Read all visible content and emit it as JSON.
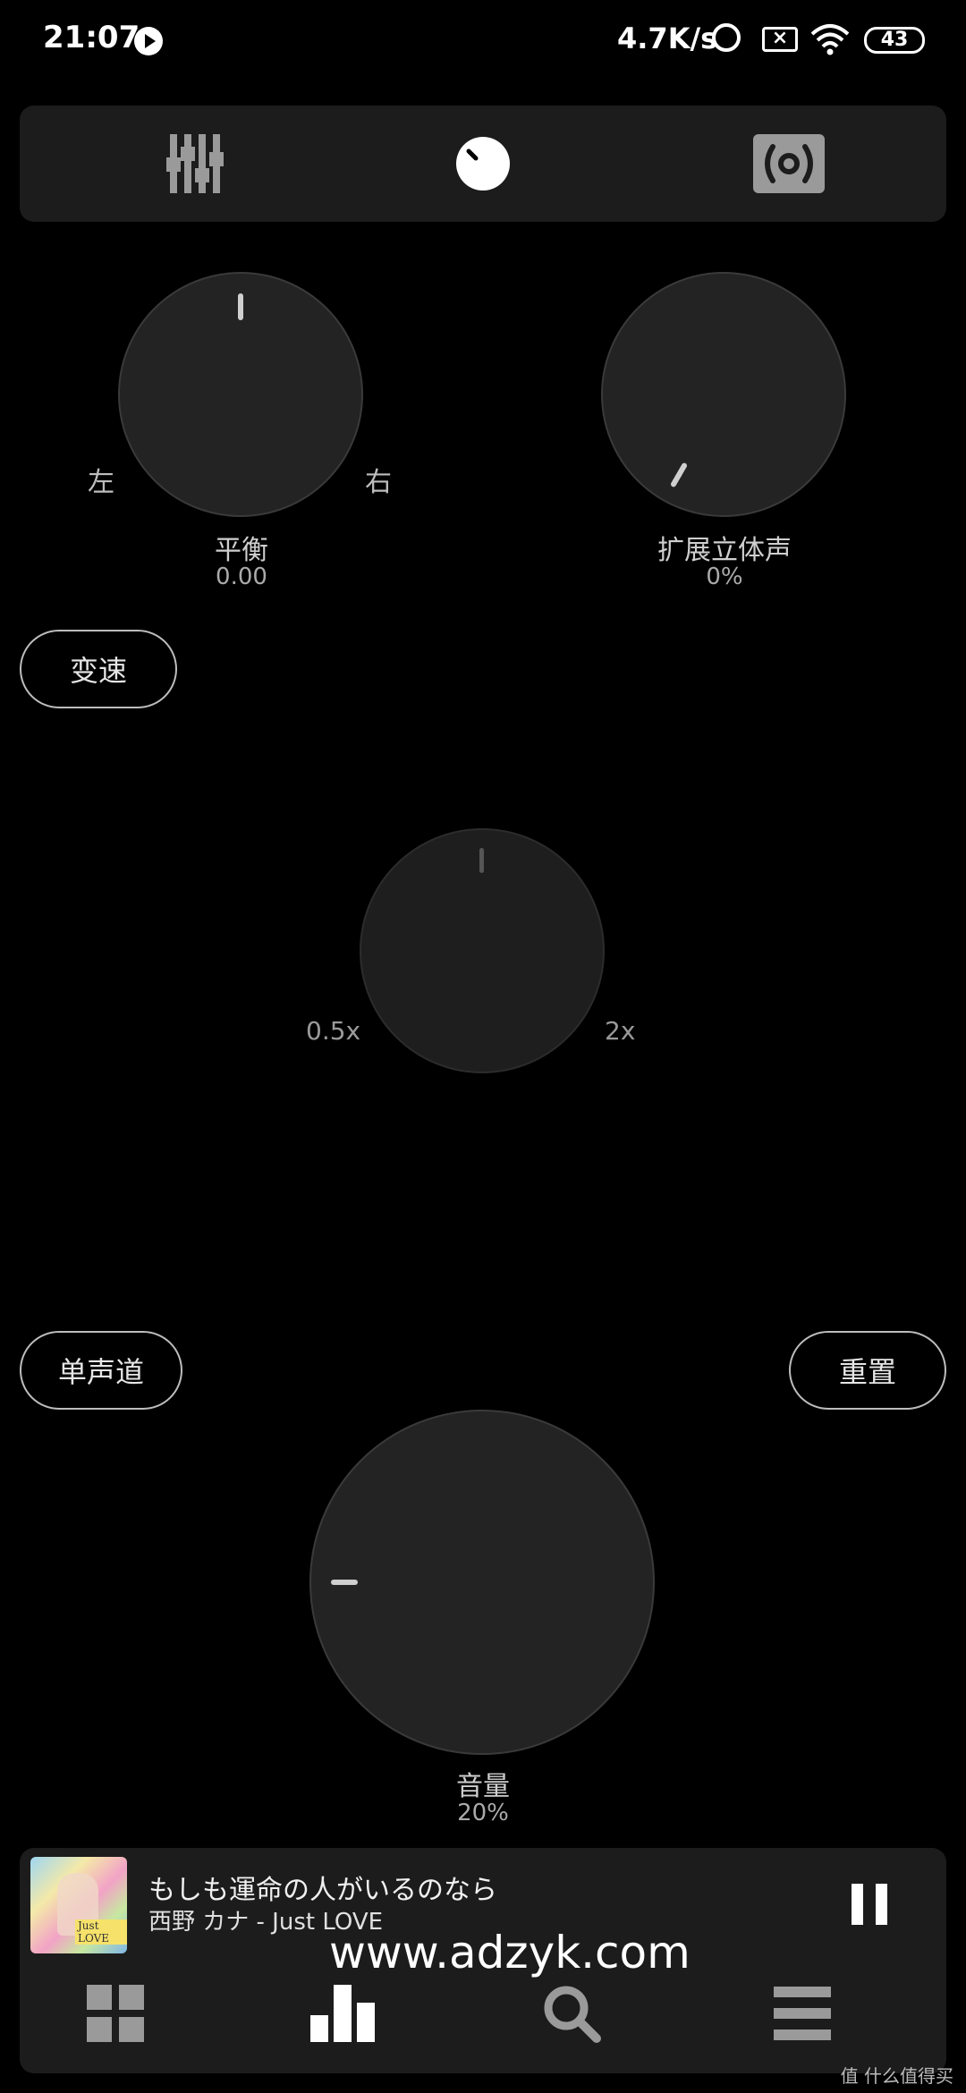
{
  "status_bar": {
    "time": "21:07",
    "network_speed": "4.7K/s",
    "battery": "43"
  },
  "tabs": [
    {
      "id": "equalizer",
      "icon": "equalizer-icon"
    },
    {
      "id": "knob",
      "icon": "knob-icon"
    },
    {
      "id": "speaker",
      "icon": "speaker-icon"
    }
  ],
  "balance": {
    "label": "平衡",
    "value": "0.00",
    "left_label": "左",
    "right_label": "右"
  },
  "stereo_expand": {
    "label": "扩展立体声",
    "value": "0%"
  },
  "speed": {
    "button_label": "变速",
    "min_label": "0.5x",
    "max_label": "2x"
  },
  "mono_button": "单声道",
  "reset_button": "重置",
  "volume": {
    "label": "音量",
    "value": "20%"
  },
  "player": {
    "title": "もしも運命の人がいるのなら",
    "artist": "西野 カナ - Just LOVE",
    "album_text": "Just LOVE"
  },
  "watermark": "www.adzyk.com",
  "bottom_nav": [
    {
      "id": "library",
      "icon": "grid-icon"
    },
    {
      "id": "now-playing",
      "icon": "bars-icon"
    },
    {
      "id": "search",
      "icon": "search-icon"
    },
    {
      "id": "menu",
      "icon": "menu-icon"
    }
  ],
  "corner_watermark": "值 什么值得买",
  "colors": {
    "background": "#000000",
    "panel": "#1c1c1c",
    "knob": "#232323",
    "text": "#e6e6e6"
  }
}
